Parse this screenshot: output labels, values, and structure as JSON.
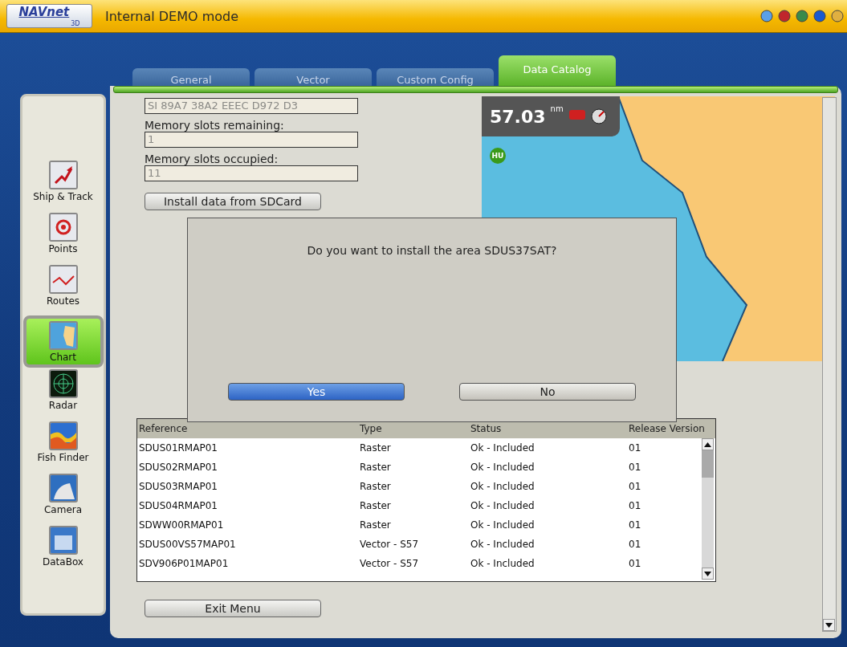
{
  "top_bar": {
    "logo": "NAVnet",
    "logo_sub": "3D",
    "title": "Internal DEMO mode"
  },
  "tabs": [
    {
      "label": "General",
      "selected": false
    },
    {
      "label": "Vector",
      "selected": false
    },
    {
      "label": "Custom Config",
      "selected": false
    },
    {
      "label": "Data Catalog",
      "selected": true
    }
  ],
  "sidebar": {
    "items": [
      {
        "label": "Ship & Track",
        "selected": false
      },
      {
        "label": "Points",
        "selected": false
      },
      {
        "label": "Routes",
        "selected": false
      },
      {
        "label": "Chart",
        "selected": true
      },
      {
        "label": "Radar",
        "selected": false
      },
      {
        "label": "Fish Finder",
        "selected": false
      },
      {
        "label": "Camera",
        "selected": false
      },
      {
        "label": "DataBox",
        "selected": false
      }
    ]
  },
  "form": {
    "serial_value": "SI 89A7 38A2 EEEC D972 D3",
    "fields": [
      {
        "label": "Memory slots remaining:",
        "value": "1"
      },
      {
        "label": "Memory slots occupied:",
        "value": "11"
      }
    ],
    "install_button": "Install data from SDCard"
  },
  "map": {
    "distance": "57.03",
    "unit": "nm",
    "badge": "HU"
  },
  "dialog": {
    "message": "Do you want to install the area SDUS37SAT?",
    "buttons": [
      {
        "label": "Yes",
        "selected": true
      },
      {
        "label": "No",
        "selected": false
      }
    ]
  },
  "table": {
    "columns": [
      "Reference",
      "Type",
      "Status",
      "Release Version"
    ],
    "rows": [
      [
        "SDUS01RMAP01",
        "Raster",
        "Ok - Included",
        "01"
      ],
      [
        "SDUS02RMAP01",
        "Raster",
        "Ok - Included",
        "01"
      ],
      [
        "SDUS03RMAP01",
        "Raster",
        "Ok - Included",
        "01"
      ],
      [
        "SDUS04RMAP01",
        "Raster",
        "Ok - Included",
        "01"
      ],
      [
        "SDWW00RMAP01",
        "Raster",
        "Ok - Included",
        "01"
      ],
      [
        "SDUS00VS57MAP01",
        "Vector - S57",
        "Ok - Included",
        "01"
      ],
      [
        "SDV906P01MAP01",
        "Vector - S57",
        "Ok - Included",
        "01"
      ]
    ]
  },
  "exit_button": "Exit Menu"
}
